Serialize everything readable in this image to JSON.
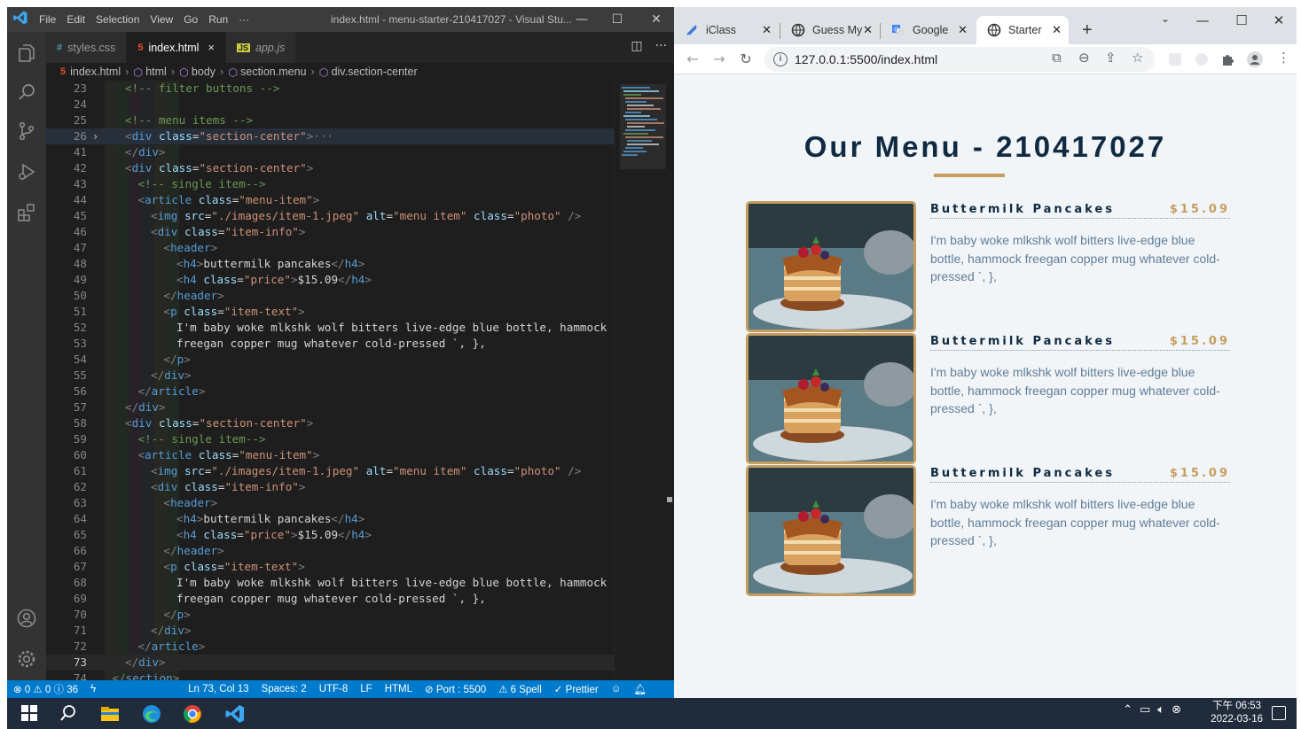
{
  "vscode": {
    "menu": [
      "File",
      "Edit",
      "Selection",
      "View",
      "Go",
      "Run",
      "···"
    ],
    "window_title": "index.html - menu-starter-210417027 - Visual Stu...",
    "tabs": [
      {
        "label": "styles.css",
        "icon": "css-icon",
        "active": false
      },
      {
        "label": "index.html",
        "icon": "html-icon",
        "active": true,
        "close": "×"
      },
      {
        "label": "app.js",
        "icon": "js-icon",
        "active": false
      }
    ],
    "breadcrumb": [
      "index.html",
      "html",
      "body",
      "section.menu",
      "div.section-center"
    ],
    "code_lines": [
      {
        "n": "23",
        "t": "<!-- filter buttons -->",
        "k": "comment",
        "ind": 2
      },
      {
        "n": "24",
        "t": "",
        "k": "blank",
        "ind": 0
      },
      {
        "n": "25",
        "t": "<!-- menu items -->",
        "k": "comment",
        "ind": 2
      },
      {
        "n": "26",
        "t": "<div class=\"section-center\">···",
        "k": "tag",
        "ind": 2,
        "fold": true,
        "hl": true
      },
      {
        "n": "41",
        "t": "</div>",
        "k": "tag",
        "ind": 2
      },
      {
        "n": "42",
        "t": "<div class=\"section-center\">",
        "k": "tag",
        "ind": 2
      },
      {
        "n": "43",
        "t": "<!-- single item-->",
        "k": "comment",
        "ind": 3
      },
      {
        "n": "44",
        "t": "<article class=\"menu-item\">",
        "k": "tag",
        "ind": 3
      },
      {
        "n": "45",
        "t": "<img src=\"./images/item-1.jpeg\" alt=\"menu item\" class=\"photo\" />",
        "k": "tag",
        "ind": 4
      },
      {
        "n": "46",
        "t": "<div class=\"item-info\">",
        "k": "tag",
        "ind": 4
      },
      {
        "n": "47",
        "t": "<header>",
        "k": "tag",
        "ind": 5
      },
      {
        "n": "48",
        "t": "<h4>buttermilk pancakes</h4>",
        "k": "tag",
        "ind": 6
      },
      {
        "n": "49",
        "t": "<h4 class=\"price\">$15.09</h4>",
        "k": "tag",
        "ind": 6
      },
      {
        "n": "50",
        "t": "</header>",
        "k": "tag",
        "ind": 5
      },
      {
        "n": "51",
        "t": "<p class=\"item-text\">",
        "k": "tag",
        "ind": 5
      },
      {
        "n": "52",
        "t": "I'm baby woke mlkshk wolf bitters live-edge blue bottle, hammock",
        "k": "text",
        "ind": 6
      },
      {
        "n": "53",
        "t": "freegan copper mug whatever cold-pressed `, },",
        "k": "text",
        "ind": 6
      },
      {
        "n": "54",
        "t": "</p>",
        "k": "tag",
        "ind": 5
      },
      {
        "n": "55",
        "t": "</div>",
        "k": "tag",
        "ind": 4
      },
      {
        "n": "56",
        "t": "</article>",
        "k": "tag",
        "ind": 3
      },
      {
        "n": "57",
        "t": "</div>",
        "k": "tag",
        "ind": 2
      },
      {
        "n": "58",
        "t": "<div class=\"section-center\">",
        "k": "tag",
        "ind": 2
      },
      {
        "n": "59",
        "t": "<!-- single item-->",
        "k": "comment",
        "ind": 3
      },
      {
        "n": "60",
        "t": "<article class=\"menu-item\">",
        "k": "tag",
        "ind": 3
      },
      {
        "n": "61",
        "t": "<img src=\"./images/item-1.jpeg\" alt=\"menu item\" class=\"photo\" />",
        "k": "tag",
        "ind": 4
      },
      {
        "n": "62",
        "t": "<div class=\"item-info\">",
        "k": "tag",
        "ind": 4
      },
      {
        "n": "63",
        "t": "<header>",
        "k": "tag",
        "ind": 5
      },
      {
        "n": "64",
        "t": "<h4>buttermilk pancakes</h4>",
        "k": "tag",
        "ind": 6
      },
      {
        "n": "65",
        "t": "<h4 class=\"price\">$15.09</h4>",
        "k": "tag",
        "ind": 6
      },
      {
        "n": "66",
        "t": "</header>",
        "k": "tag",
        "ind": 5
      },
      {
        "n": "67",
        "t": "<p class=\"item-text\">",
        "k": "tag",
        "ind": 5
      },
      {
        "n": "68",
        "t": "I'm baby woke mlkshk wolf bitters live-edge blue bottle, hammock",
        "k": "text",
        "ind": 6
      },
      {
        "n": "69",
        "t": "freegan copper mug whatever cold-pressed `, },",
        "k": "text",
        "ind": 6
      },
      {
        "n": "70",
        "t": "</p>",
        "k": "tag",
        "ind": 5
      },
      {
        "n": "71",
        "t": "</div>",
        "k": "tag",
        "ind": 4
      },
      {
        "n": "72",
        "t": "</article>",
        "k": "tag",
        "ind": 3
      },
      {
        "n": "73",
        "t": "</div>",
        "k": "tag",
        "ind": 2,
        "cur": true
      },
      {
        "n": "74",
        "t": "</section>",
        "k": "tag",
        "ind": 1
      }
    ],
    "status": {
      "problems": "⊗ 0 ⚠ 0 ⓘ 36",
      "sync": "ϟ",
      "position": "Ln 73, Col 13",
      "spaces": "Spaces: 2",
      "encoding": "UTF-8",
      "eol": "LF",
      "language": "HTML",
      "port": "⊘ Port : 5500",
      "spell": "⚠ 6 Spell",
      "prettier": "✓ Prettier"
    },
    "colors": {
      "tag": "#569cd6",
      "attr": "#9cdcfe",
      "string": "#ce9178",
      "comment": "#6a9955",
      "text": "#d4d4d4",
      "status": "#007acc"
    }
  },
  "chrome": {
    "tabs": [
      {
        "label": "iClass",
        "icon": "iclass-icon"
      },
      {
        "label": "Guess My",
        "icon": "globe-icon"
      },
      {
        "label": "Google",
        "icon": "translate-icon"
      },
      {
        "label": "Starter",
        "icon": "globe-icon",
        "active": true
      }
    ],
    "new_tab": "+",
    "url": "127.0.0.1:5500/index.html",
    "page": {
      "title": "Our Menu - 210417027",
      "items": [
        {
          "name": "Buttermilk Pancakes",
          "price": "$15.09",
          "text": "I'm baby woke mlkshk wolf bitters live-edge blue bottle, hammock freegan copper mug whatever cold-pressed `, },"
        },
        {
          "name": "Buttermilk Pancakes",
          "price": "$15.09",
          "text": "I'm baby woke mlkshk wolf bitters live-edge blue bottle, hammock freegan copper mug whatever cold-pressed `, },"
        },
        {
          "name": "Buttermilk Pancakes",
          "price": "$15.09",
          "text": "I'm baby woke mlkshk wolf bitters live-edge blue bottle, hammock freegan copper mug whatever cold-pressed `, },"
        }
      ],
      "colors": {
        "title": "#102a42",
        "accent": "#c59d5f",
        "text": "#617d98",
        "background": "#f1f5f8"
      }
    }
  },
  "taskbar": {
    "clock_time": "下午 06:53",
    "clock_date": "2022-03-16"
  }
}
